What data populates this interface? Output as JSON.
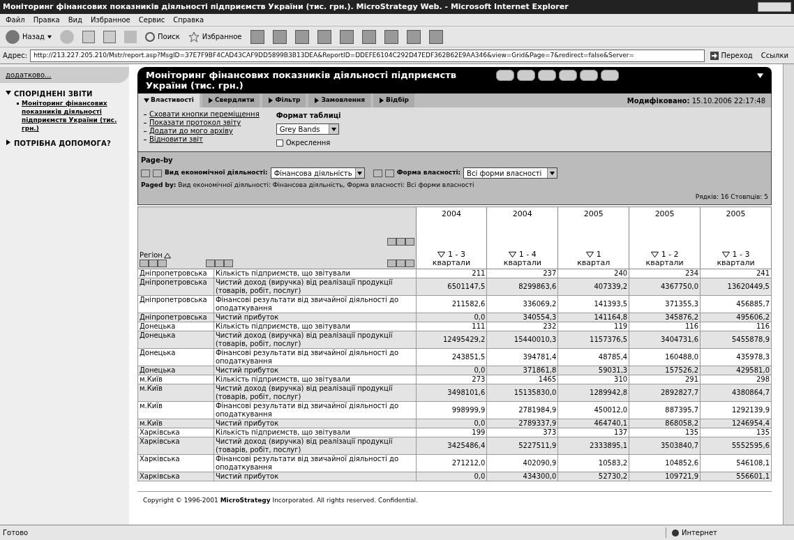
{
  "window": {
    "title": "Моніторинг фінансових показників діяльності підприємств України (тис. грн.). MicroStrategy Web. - Microsoft Internet Explorer"
  },
  "menu": [
    "Файл",
    "Правка",
    "Вид",
    "Избранное",
    "Сервис",
    "Справка"
  ],
  "toolbar": {
    "back": "Назад",
    "search": "Поиск",
    "favorites": "Избранное"
  },
  "address": {
    "label": "Адрес:",
    "value": "http://213.227.205.210/Mstr/report.asp?MsgID=37E7F9BF4CAD43CAF9DD5899B3B13DEA&ReportID=DDEFE6104C292D47EDF362B62E9AA346&view=Grid&Page=7&redirect=false&Server=",
    "go": "Переход",
    "links": "Ссылки"
  },
  "sidebar": {
    "more": "додатково...",
    "sections": [
      {
        "title": "СПОРІДНЕНІ ЗВІТИ",
        "expanded": true,
        "items": [
          "Моніторинг фінансових показників діяльності підприємств України (тис. грн.)"
        ]
      },
      {
        "title": "ПОТРІБНА ДОПОМОГА?",
        "expanded": false
      }
    ]
  },
  "report": {
    "title": "Моніторинг фінансових показників діяльності підприємств України (тис. грн.)",
    "tabs": [
      {
        "label": "Властивості",
        "selected": true
      },
      {
        "label": "Свердлити",
        "selected": false
      },
      {
        "label": "Фільтр",
        "selected": false
      },
      {
        "label": "Замовлення",
        "selected": false
      },
      {
        "label": "Відбір",
        "selected": false
      }
    ],
    "modified_label": "Модифіковано:",
    "modified": "15.10.2006 22:17:48",
    "links": [
      "Сховати кнопки переміщення",
      "Показати протокол звіту",
      "Додати до мого архіву",
      "Відновити звіт"
    ],
    "format_label": "Формат таблиці",
    "format_value": "Grey Bands",
    "outline": {
      "label": "Окреслення",
      "checked": false
    },
    "page_by": {
      "title": "Page-by",
      "fields": [
        {
          "label": "Вид економічної діяльності:",
          "value": "Фінансова діяльність"
        },
        {
          "label": "Форма власності:",
          "value": "Всі форми власності"
        }
      ],
      "paged_label": "Paged by:",
      "paged_text": "Вид економічної діяльності: Фінансова діяльність,  Форма власності: Всі форми власності"
    },
    "counts": "Рядків: 16  Стовпців: 5",
    "region_header": "Регіон",
    "columns": [
      {
        "year": "2004",
        "period": "1 - 3",
        "unit": "квартали"
      },
      {
        "year": "2004",
        "period": "1 - 4",
        "unit": "квартали"
      },
      {
        "year": "2005",
        "period": "1",
        "unit": "квартал"
      },
      {
        "year": "2005",
        "period": "1 - 2",
        "unit": "квартали"
      },
      {
        "year": "2005",
        "period": "1 - 3",
        "unit": "квартали"
      }
    ],
    "rows": [
      {
        "region": "Дніпропетровська",
        "metric": "Кількість підприємств, що звітували",
        "values": [
          "211",
          "237",
          "240",
          "234",
          "241"
        ]
      },
      {
        "region": "Дніпропетровська",
        "metric": "Чистий доход (виручка) від реалізації продукції (товарів, робіт, послуг)",
        "values": [
          "6501147,5",
          "8299863,6",
          "407339,2",
          "4367750,0",
          "13620449,5"
        ]
      },
      {
        "region": "Дніпропетровська",
        "metric": "Фінансові результати від звичайної діяльності до оподаткування",
        "values": [
          "211582,6",
          "336069,2",
          "141393,5",
          "371355,3",
          "456885,7"
        ]
      },
      {
        "region": "Дніпропетровська",
        "metric": "Чистий прибуток",
        "values": [
          "0,0",
          "340554,3",
          "141164,8",
          "345876,2",
          "495606,2"
        ]
      },
      {
        "region": "Донецька",
        "metric": "Кількість підприємств, що звітували",
        "values": [
          "111",
          "232",
          "119",
          "116",
          "116"
        ]
      },
      {
        "region": "Донецька",
        "metric": "Чистий доход (виручка) від реалізації продукції (товарів, робіт, послуг)",
        "values": [
          "12495429,2",
          "15440010,3",
          "1157376,5",
          "3404731,6",
          "5455878,9"
        ]
      },
      {
        "region": "Донецька",
        "metric": "Фінансові результати від звичайної діяльності до оподаткування",
        "values": [
          "243851,5",
          "394781,4",
          "48785,4",
          "160488,0",
          "435978,3"
        ]
      },
      {
        "region": "Донецька",
        "metric": "Чистий прибуток",
        "values": [
          "0,0",
          "371861,8",
          "59031,3",
          "157526,2",
          "429581,0"
        ]
      },
      {
        "region": "м.Київ",
        "metric": "Кількість підприємств, що звітували",
        "values": [
          "273",
          "1465",
          "310",
          "291",
          "298"
        ]
      },
      {
        "region": "м.Київ",
        "metric": "Чистий доход (виручка) від реалізації продукції (товарів, робіт, послуг)",
        "values": [
          "3498101,6",
          "15135830,0",
          "1289942,8",
          "2892827,7",
          "4380864,7"
        ]
      },
      {
        "region": "м.Київ",
        "metric": "Фінансові результати від звичайної діяльності до оподаткування",
        "values": [
          "998999,9",
          "2781984,9",
          "450012,0",
          "887395,7",
          "1292139,9"
        ]
      },
      {
        "region": "м.Київ",
        "metric": "Чистий прибуток",
        "values": [
          "0,0",
          "2789337,9",
          "464740,1",
          "868058,2",
          "1246954,4"
        ]
      },
      {
        "region": "Харківська",
        "metric": "Кількість підприємств, що звітували",
        "values": [
          "199",
          "373",
          "137",
          "135",
          "135"
        ]
      },
      {
        "region": "Харківська",
        "metric": "Чистий доход (виручка) від реалізації продукції (товарів, робіт, послуг)",
        "values": [
          "3425486,4",
          "5227511,9",
          "2333895,1",
          "3503840,7",
          "5552595,6"
        ]
      },
      {
        "region": "Харківська",
        "metric": "Фінансові результати від звичайної діяльності до оподаткування",
        "values": [
          "271212,0",
          "402090,9",
          "10583,2",
          "104852,6",
          "546108,1"
        ]
      },
      {
        "region": "Харківська",
        "metric": "Чистий прибуток",
        "values": [
          "0,0",
          "434300,0",
          "52730,2",
          "109721,9",
          "556601,1"
        ]
      }
    ]
  },
  "copyright": "Copyright © 1996-2001 **MicroStrategy** Incorporated. All rights reserved. Confidential.",
  "status_bar": {
    "text": "Готово",
    "zone": "Интернет"
  }
}
